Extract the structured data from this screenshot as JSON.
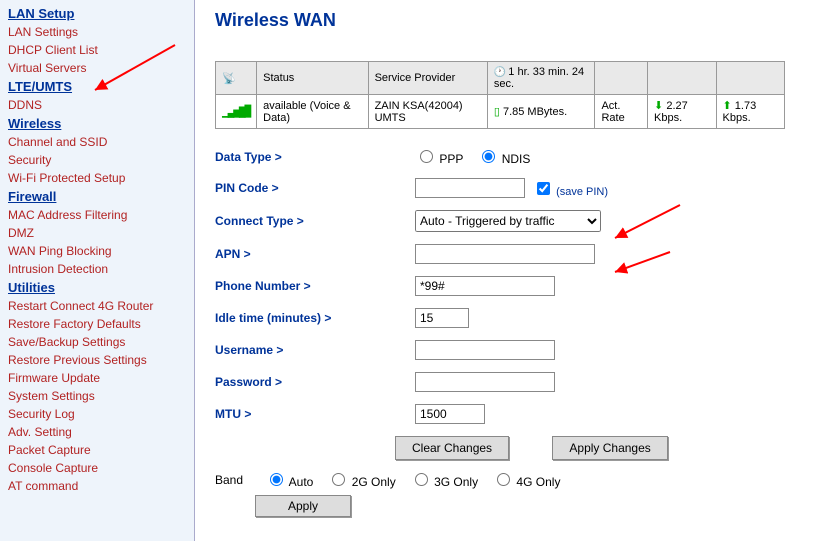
{
  "page": {
    "title": "Wireless WAN"
  },
  "sidebar": {
    "sections": [
      {
        "header": "LAN Setup",
        "items": [
          "LAN Settings",
          "DHCP Client List",
          "Virtual Servers"
        ]
      },
      {
        "header": "LTE/UMTS",
        "items": [
          "DDNS"
        ]
      },
      {
        "header": "Wireless",
        "items": [
          "Channel and SSID",
          "Security",
          "Wi-Fi Protected Setup"
        ]
      },
      {
        "header": "Firewall",
        "items": [
          "MAC Address Filtering",
          "DMZ",
          "WAN Ping Blocking",
          "Intrusion Detection"
        ]
      },
      {
        "header": "Utilities",
        "items": [
          "Restart Connect 4G Router",
          "Restore Factory Defaults",
          "Save/Backup Settings",
          "Restore Previous Settings",
          "Firmware Update",
          "System Settings",
          "Security Log",
          "Adv. Setting",
          "Packet Capture",
          "Console Capture",
          "AT command"
        ]
      }
    ]
  },
  "status_table": {
    "headers": {
      "status": "Status",
      "provider": "Service Provider",
      "duration": "1 hr. 33 min. 24 sec.",
      "rate_label": "Act. Rate"
    },
    "row": {
      "status": "available (Voice & Data)",
      "provider": "ZAIN KSA(42004) UMTS",
      "data": "7.85 MBytes.",
      "down": "2.27 Kbps.",
      "up": "1.73 Kbps."
    }
  },
  "form": {
    "data_type_label": "Data Type >",
    "data_type_options": {
      "ppp": "PPP",
      "ndis": "NDIS"
    },
    "data_type_selected": "ndis",
    "pin_code_label": "PIN Code >",
    "pin_code_value": "",
    "save_pin_label": "(save PIN)",
    "save_pin_checked": true,
    "connect_type_label": "Connect Type >",
    "connect_type_value": "Auto - Triggered by traffic",
    "apn_label": "APN >",
    "apn_value": "",
    "phone_label": "Phone Number >",
    "phone_value": "*99#",
    "idle_label": "Idle time (minutes) >",
    "idle_value": "15",
    "username_label": "Username >",
    "username_value": "",
    "password_label": "Password >",
    "password_value": "",
    "mtu_label": "MTU >",
    "mtu_value": "1500",
    "btn_clear": "Clear Changes",
    "btn_apply": "Apply Changes"
  },
  "band": {
    "label": "Band",
    "options": [
      "Auto",
      "2G Only",
      "3G Only",
      "4G Only"
    ],
    "selected": "Auto",
    "apply": "Apply"
  },
  "annotation": {
    "color": "#ff0000"
  }
}
